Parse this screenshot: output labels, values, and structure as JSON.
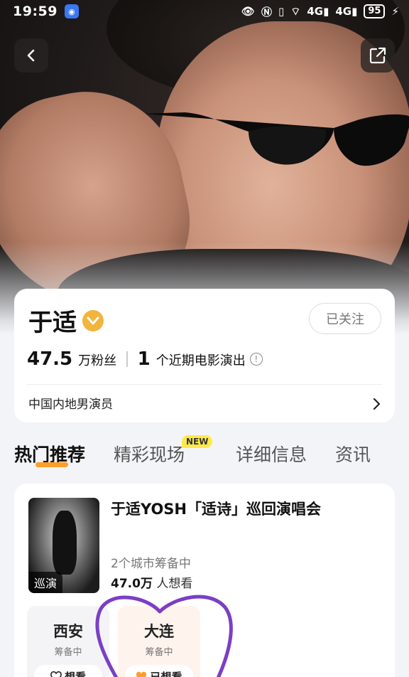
{
  "status_bar": {
    "time": "19:59",
    "network_1": "4G",
    "network_2": "4G",
    "battery": "95"
  },
  "profile": {
    "name": "于适",
    "follow_label": "已关注",
    "fans_count": "47.5",
    "fans_unit": "万粉丝",
    "shows_count": "1",
    "shows_unit": "个近期电影演出",
    "profession": "中国内地男演员"
  },
  "tabs": [
    {
      "label": "热门推荐",
      "active": true
    },
    {
      "label": "精彩现场",
      "badge": "NEW"
    },
    {
      "label": "详细信息"
    },
    {
      "label": "资讯"
    }
  ],
  "event": {
    "poster_tag": "巡演",
    "title": "于适YOSH「适诗」巡回演唱会",
    "status": "2个城市筹备中",
    "want_count": "47.0万",
    "want_unit": "人想看",
    "cities": [
      {
        "name": "西安",
        "state": "筹备中",
        "button": "想看",
        "wanted": false
      },
      {
        "name": "大连",
        "state": "筹备中",
        "button": "已想看",
        "wanted": true
      }
    ]
  },
  "colors": {
    "accent": "#ff9d2a",
    "verified": "#f2b43c",
    "annotation": "#7b3fc4"
  }
}
